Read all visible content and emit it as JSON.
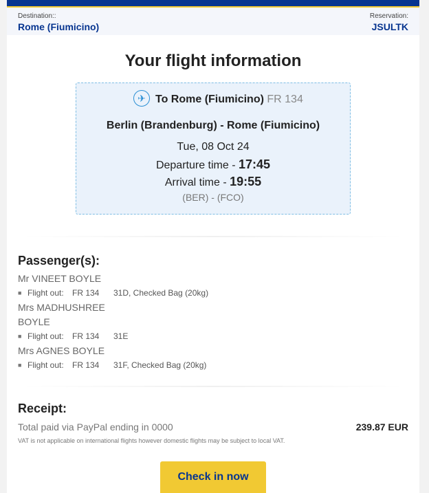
{
  "reservation_header": {
    "destination_label": "Destination::",
    "destination_value": "Rome (Fiumicino)",
    "reservation_label": "Reservation:",
    "reservation_value": "JSULTK"
  },
  "page_title": "Your flight information",
  "flight": {
    "icon": "plane-icon",
    "to_label": "To Rome (Fiumicino)",
    "flight_number": "FR 134",
    "route": "Berlin (Brandenburg) - Rome (Fiumicino)",
    "date": "Tue, 08 Oct 24",
    "departure_label": "Departure time - ",
    "departure_time": "17:45",
    "arrival_label": "Arrival time - ",
    "arrival_time": "19:55",
    "codes": "(BER) - (FCO)"
  },
  "passengers": {
    "title": "Passenger(s):",
    "list": [
      {
        "name": "Mr VINEET BOYLE",
        "flight_label": "Flight out:",
        "flight": "FR 134",
        "seat": "31D, Checked Bag (20kg)"
      },
      {
        "name_line1": "Mrs MADHUSHREE",
        "name_line2": "BOYLE",
        "flight_label": "Flight out:",
        "flight": "FR 134",
        "seat": "31E"
      },
      {
        "name": "Mrs AGNES BOYLE",
        "flight_label": "Flight out:",
        "flight": "FR 134",
        "seat": "31F, Checked Bag (20kg)"
      }
    ]
  },
  "receipt": {
    "title": "Receipt:",
    "paid_text": "Total paid via PayPal ending in 0000",
    "amount": "239.87 EUR",
    "vat_note": "VAT is not applicable on international flights however domestic flights may be subject to local VAT."
  },
  "cta": {
    "checkin_label": "Check in now"
  },
  "colors": {
    "brand_blue": "#073590",
    "brand_yellow": "#f1c933",
    "box_bg": "#eaf2fb",
    "icon_blue": "#2a8fd4"
  }
}
